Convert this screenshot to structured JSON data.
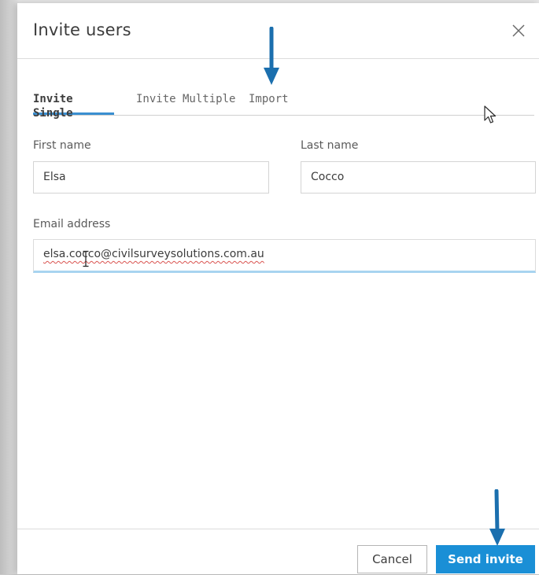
{
  "dialog": {
    "title": "Invite users",
    "close_icon": "close-icon"
  },
  "tabs": [
    {
      "label": "Invite Single",
      "active": true
    },
    {
      "label": "Invite Multiple",
      "active": false
    },
    {
      "label": "Import",
      "active": false
    }
  ],
  "form": {
    "first_name": {
      "label": "First name",
      "value": "Elsa"
    },
    "last_name": {
      "label": "Last name",
      "value": "Cocco"
    },
    "email": {
      "label": "Email address",
      "value": "elsa.cocco@civilsurveysolutions.com.au"
    }
  },
  "footer": {
    "cancel_label": "Cancel",
    "send_label": "Send invite"
  },
  "annotations": {
    "arrow_color": "#1b6fae",
    "pointer_icon": "mouse-pointer-icon",
    "text_cursor_icon": "text-cursor-icon"
  },
  "colors": {
    "accent": "#1a8fd6",
    "tab_underline": "#3a8fd1",
    "focus_underline": "#a8d4f0"
  }
}
